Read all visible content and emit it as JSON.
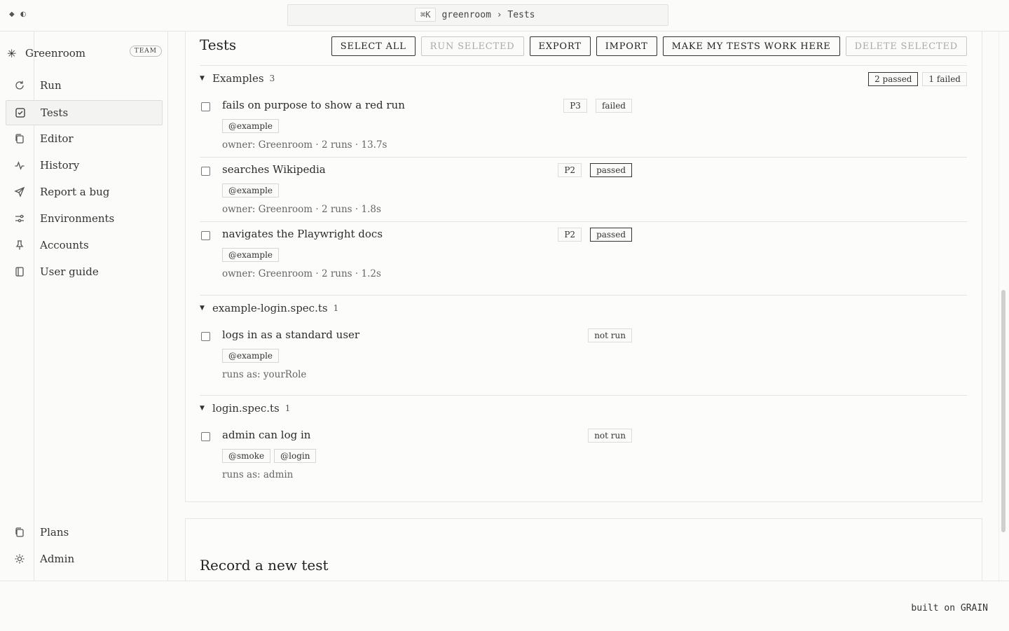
{
  "topbar": {
    "icons": [
      "diamond-icon",
      "contrast-icon"
    ],
    "shortcut": "⌘K",
    "breadcrumb": "greenroom › Tests"
  },
  "sidebar": {
    "brand": "Greenroom",
    "badge": "TEAM",
    "items": [
      {
        "label": "Run",
        "icon": "refresh-icon"
      },
      {
        "label": "Tests",
        "icon": "checkbox-icon",
        "active": true
      },
      {
        "label": "Editor",
        "icon": "copy-icon"
      },
      {
        "label": "History",
        "icon": "activity-icon"
      },
      {
        "label": "Report a bug",
        "icon": "send-icon"
      },
      {
        "label": "Environments",
        "icon": "sliders-icon"
      },
      {
        "label": "Accounts",
        "icon": "pin-icon"
      },
      {
        "label": "User guide",
        "icon": "book-icon"
      }
    ],
    "bottom_items": [
      {
        "label": "Plans",
        "icon": "copy-icon"
      },
      {
        "label": "Admin",
        "icon": "sun-gear-icon"
      }
    ]
  },
  "main": {
    "title": "Tests",
    "actions": {
      "select_all": "SELECT ALL",
      "run_selected": "RUN SELECTED",
      "export": "EXPORT",
      "import": "IMPORT",
      "make_work": "MAKE MY TESTS WORK HERE",
      "delete_selected": "DELETE SELECTED"
    },
    "groups": [
      {
        "name": "Examples",
        "count": "3",
        "summary": [
          "2 passed",
          "1 failed"
        ],
        "tests": [
          {
            "name": "fails on purpose to show a red run",
            "tags": [
              "@example"
            ],
            "meta": "owner: Greenroom · 2 runs · 13.7s",
            "priority": "P3",
            "status": "failed"
          },
          {
            "name": "searches Wikipedia",
            "tags": [
              "@example"
            ],
            "meta": "owner: Greenroom · 2 runs · 1.8s",
            "priority": "P2",
            "status": "passed"
          },
          {
            "name": "navigates the Playwright docs",
            "tags": [
              "@example"
            ],
            "meta": "owner: Greenroom · 2 runs · 1.2s",
            "priority": "P2",
            "status": "passed"
          }
        ]
      },
      {
        "name": "example-login.spec.ts",
        "count": "1",
        "tests": [
          {
            "name": "logs in as a standard user",
            "tags": [
              "@example"
            ],
            "meta": "runs as: yourRole",
            "status": "not run"
          }
        ]
      },
      {
        "name": "login.spec.ts",
        "count": "1",
        "tests": [
          {
            "name": "admin can log in",
            "tags": [
              "@smoke",
              "@login"
            ],
            "meta": "runs as: admin",
            "status": "not run"
          }
        ]
      }
    ],
    "record_title": "Record a new test"
  },
  "footer": {
    "built_on": "built on GRAIN"
  }
}
